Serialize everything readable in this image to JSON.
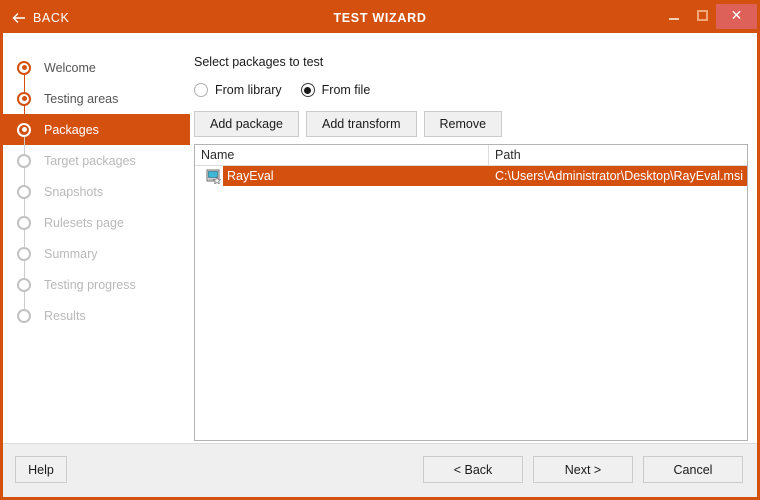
{
  "window": {
    "title": "TEST WIZARD",
    "back_label": "BACK",
    "back_icon": "arrow-left-icon",
    "minimize_icon": "minimize-icon",
    "maximize_icon": "maximize-icon",
    "close_icon": "close-icon",
    "close_glyph": "✕",
    "accent_color": "#d4500f",
    "close_button_color": "#dd6059"
  },
  "sidebar": {
    "steps": [
      {
        "label": "Welcome",
        "state": "done"
      },
      {
        "label": "Testing areas",
        "state": "done"
      },
      {
        "label": "Packages",
        "state": "active"
      },
      {
        "label": "Target packages",
        "state": "pending"
      },
      {
        "label": "Snapshots",
        "state": "pending"
      },
      {
        "label": "Rulesets page",
        "state": "pending"
      },
      {
        "label": "Summary",
        "state": "pending"
      },
      {
        "label": "Testing progress",
        "state": "pending"
      },
      {
        "label": "Results",
        "state": "pending"
      }
    ]
  },
  "main": {
    "title": "Select packages to test",
    "source_options": [
      {
        "label": "From library",
        "checked": false
      },
      {
        "label": "From file",
        "checked": true
      }
    ],
    "actions": [
      {
        "label": "Add package"
      },
      {
        "label": "Add transform"
      },
      {
        "label": "Remove"
      }
    ],
    "list": {
      "columns": [
        {
          "label": "Name"
        },
        {
          "label": "Path"
        }
      ],
      "rows": [
        {
          "icon": "msi-package-icon",
          "name": "RayEval",
          "path": "C:\\Users\\Administrator\\Desktop\\RayEval.msi",
          "selected": true
        }
      ]
    }
  },
  "footer": {
    "help_label": "Help",
    "back_label": "< Back",
    "next_label": "Next >",
    "cancel_label": "Cancel"
  }
}
